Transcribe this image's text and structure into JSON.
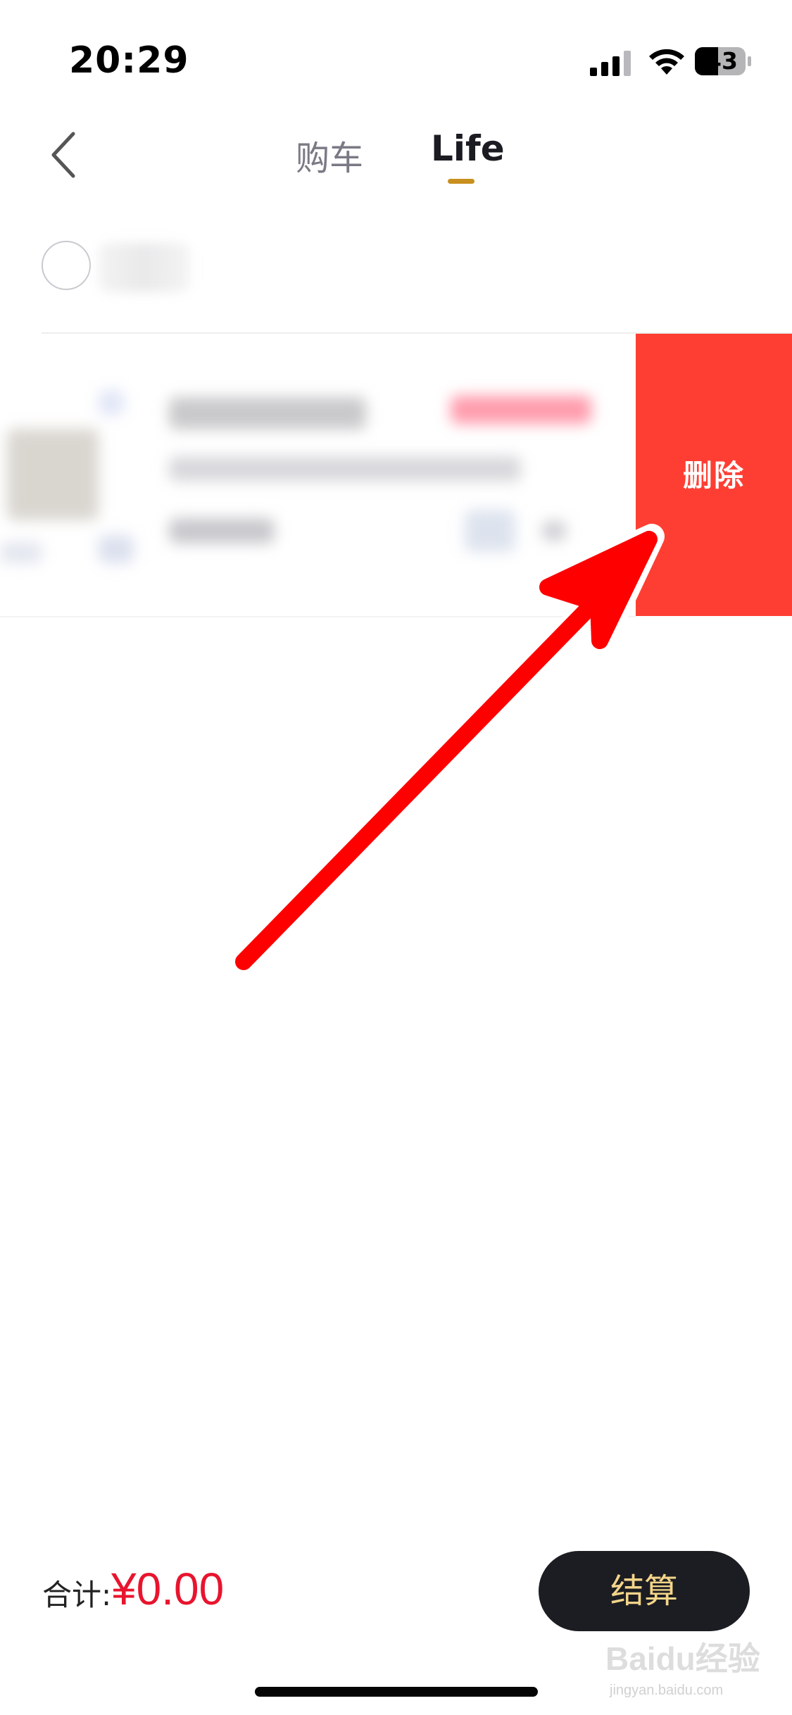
{
  "status_bar": {
    "time": "20:29",
    "battery": "43",
    "icons": [
      "signal-icon",
      "wifi-icon",
      "battery-icon"
    ]
  },
  "nav": {
    "back_icon": "chevron-left-icon",
    "tabs": [
      {
        "label": "购车",
        "active": false
      },
      {
        "label": "Life",
        "active": true
      }
    ],
    "active_color": "#c8901e"
  },
  "cart": {
    "delete_label": "删除",
    "delete_color": "#ff3e33"
  },
  "footer": {
    "total_label": "合计:",
    "total_value": "¥0.00",
    "checkout_label": "结算",
    "price_color": "#e8142e",
    "checkout_bg": "#1c1d22",
    "checkout_text_color": "#f3d58a"
  },
  "watermark": {
    "brand": "Baidu经验",
    "url": "jingyan.baidu.com"
  },
  "annotation": {
    "icon": "red-arrow-icon",
    "color": "#ff0000"
  }
}
